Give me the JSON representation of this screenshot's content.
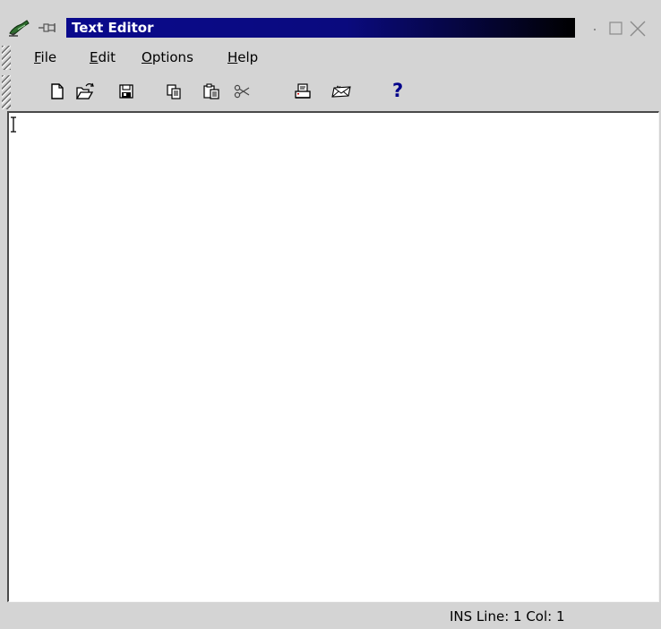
{
  "window": {
    "title": "Text Editor",
    "title_color": "#ffffff",
    "titlebar_gradient": [
      "#0a0a8c",
      "#000000"
    ],
    "frame_color": "#d4d4d4",
    "icons": {
      "app": "editor-pen-icon",
      "sticky": "pin-icon",
      "minimize": "minimize-icon",
      "maximize": "maximize-icon",
      "close": "close-icon"
    }
  },
  "menubar": {
    "items": [
      {
        "mnemonic": "F",
        "rest": "ile"
      },
      {
        "mnemonic": "E",
        "rest": "dit"
      },
      {
        "mnemonic": "O",
        "rest": "ptions"
      },
      {
        "mnemonic": "H",
        "rest": "elp"
      }
    ]
  },
  "toolbar": {
    "buttons": [
      {
        "icon": "new-document-icon"
      },
      {
        "icon": "open-folder-icon"
      },
      {
        "icon": "save-disk-icon"
      },
      {
        "icon": "copy-icon"
      },
      {
        "icon": "paste-icon"
      },
      {
        "icon": "cut-scissors-icon"
      },
      {
        "icon": "print-icon"
      },
      {
        "icon": "mail-icon"
      },
      {
        "icon": "help-icon",
        "glyph": "?"
      }
    ],
    "help_glyph_color": "#00008a"
  },
  "editor": {
    "content": ""
  },
  "statusbar": {
    "text": "INS  Line: 1 Col: 1"
  }
}
